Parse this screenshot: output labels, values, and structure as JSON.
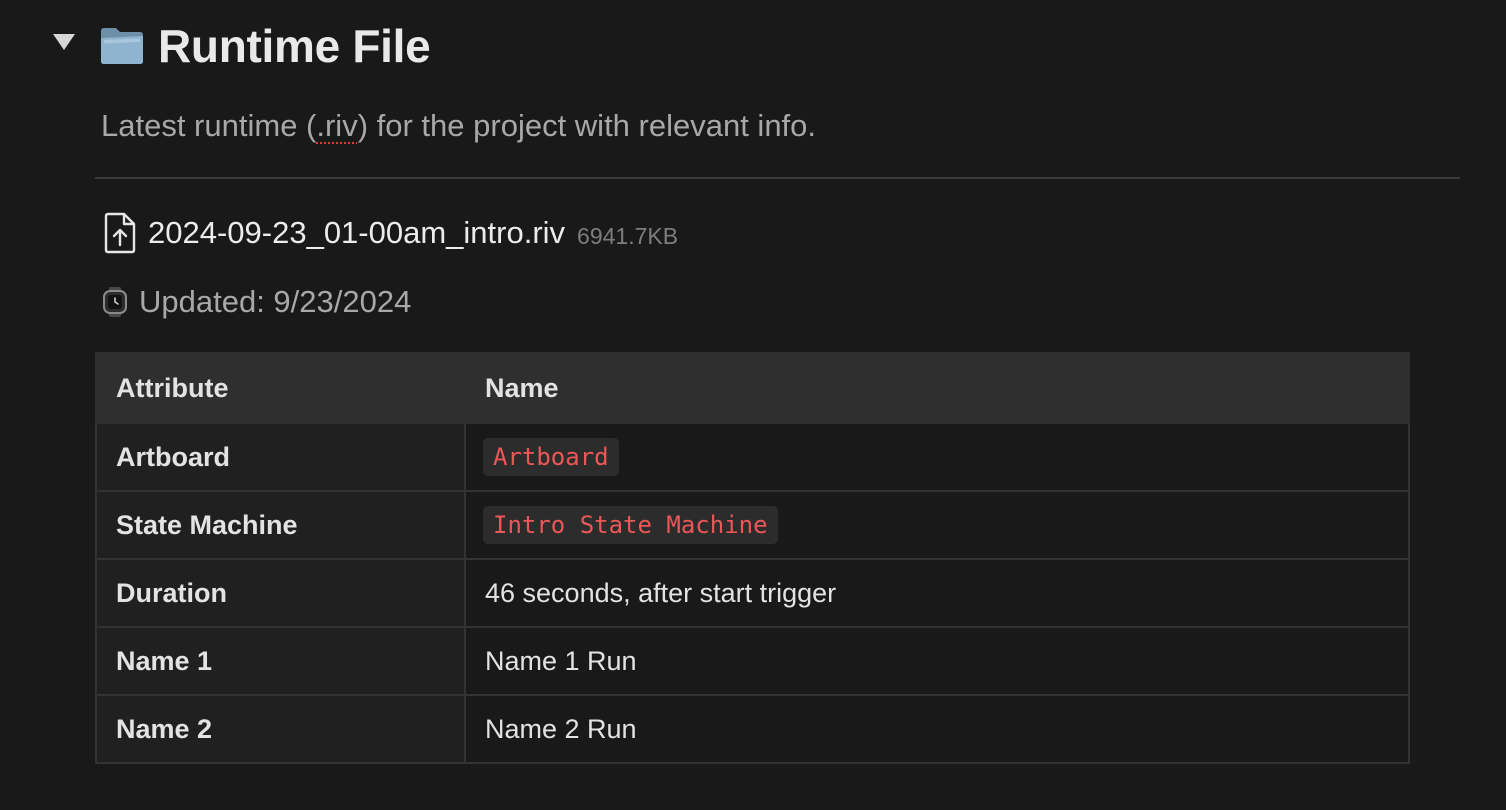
{
  "toggle": {
    "state": "expanded",
    "icon": "triangle-down-icon"
  },
  "heading": {
    "icon": "folder-icon",
    "title": "Runtime File"
  },
  "description": {
    "before": "Latest runtime (",
    "flagged_word": ".riv",
    "after": ") for the project with relevant info."
  },
  "file": {
    "icon": "file-upload-icon",
    "name": "2024-09-23_01-00am_intro.riv",
    "size": "6941.7KB"
  },
  "updated": {
    "icon": "watch-icon",
    "text": "Updated: 9/23/2024"
  },
  "table": {
    "headers": [
      "Attribute",
      "Name"
    ],
    "rows": [
      {
        "attribute": "Artboard",
        "value": "Artboard",
        "is_code": true
      },
      {
        "attribute": "State Machine",
        "value": "Intro State Machine",
        "is_code": true
      },
      {
        "attribute": "Duration",
        "value": "46 seconds, after start trigger",
        "is_code": false
      },
      {
        "attribute": "Name 1",
        "value": "Name 1 Run",
        "is_code": false
      },
      {
        "attribute": "Name 2",
        "value": "Name 2 Run",
        "is_code": false
      }
    ]
  },
  "colors": {
    "background": "#191919",
    "code_text": "#eb5757",
    "code_background": "#2c2c2c",
    "header_row": "#2f2f2f",
    "muted_text": "#a8a8a8"
  }
}
